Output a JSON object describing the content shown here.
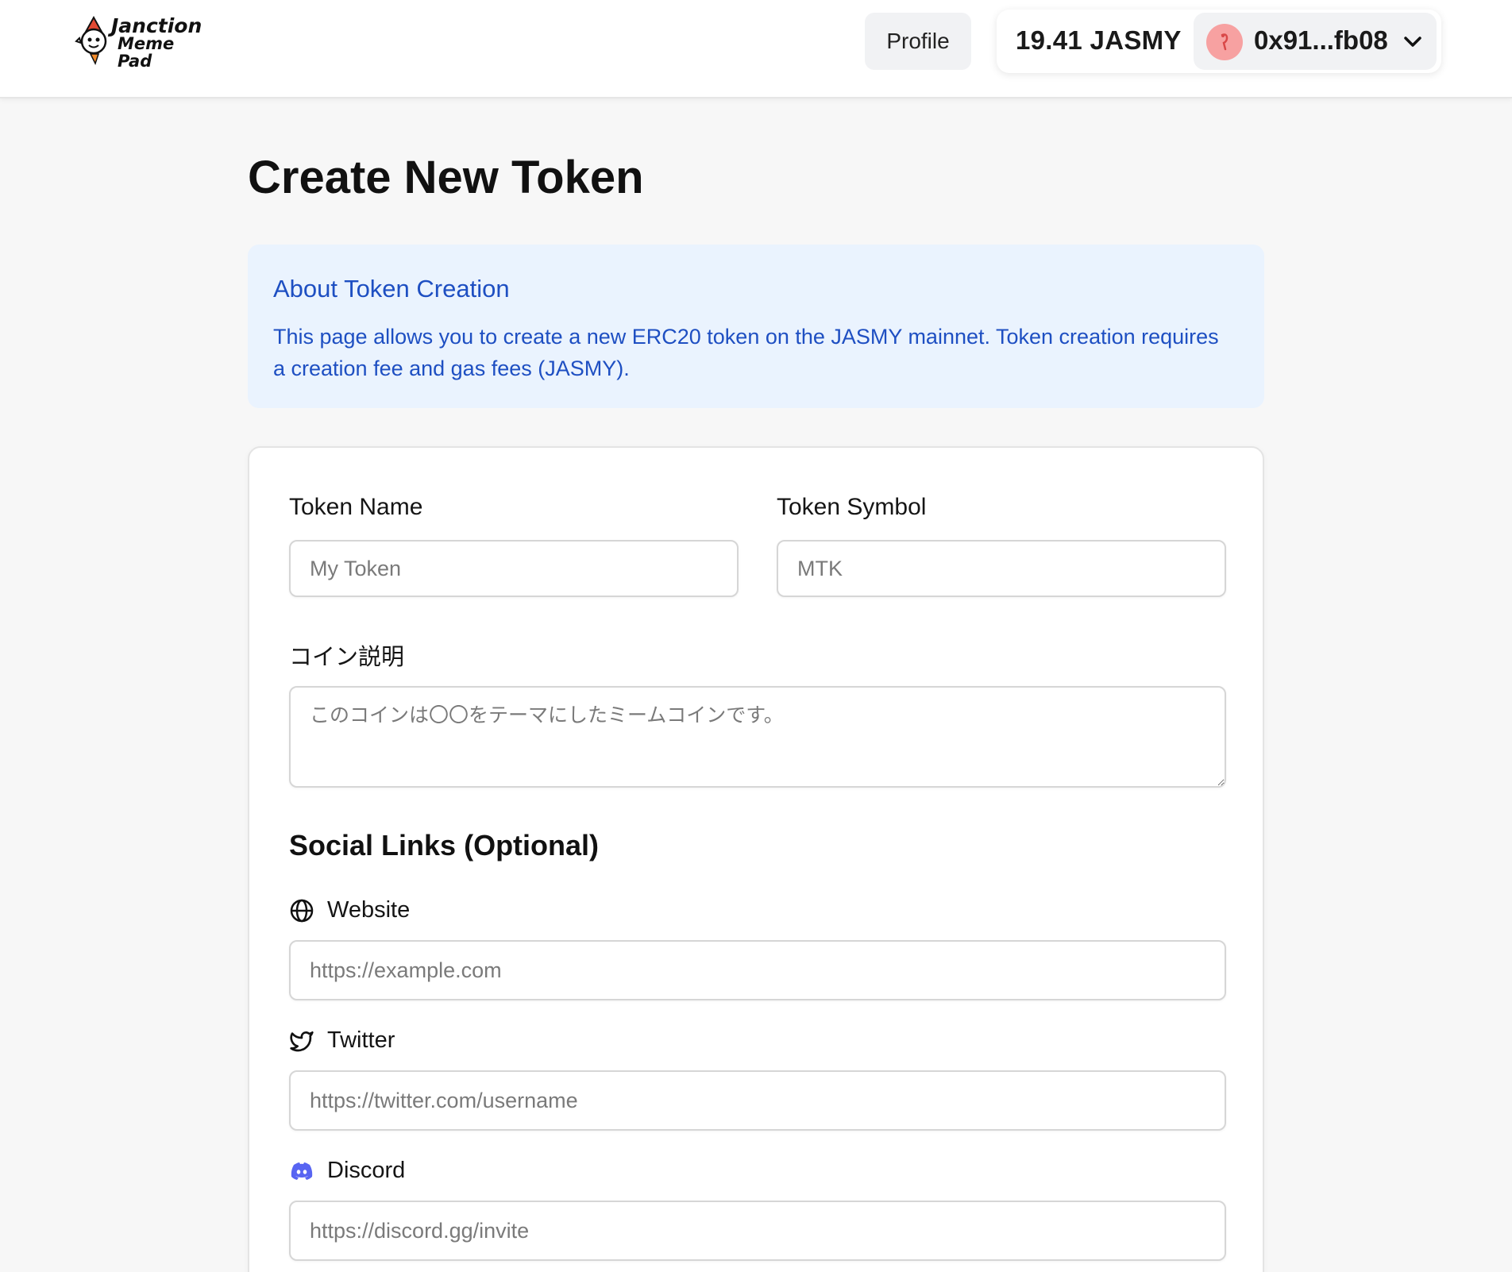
{
  "header": {
    "logo": {
      "line1": "Janction",
      "line2": "Meme Pad"
    },
    "profile_label": "Profile",
    "balance": "19.41 JASMY",
    "address": "0x91...fb08"
  },
  "page": {
    "title": "Create New Token"
  },
  "info": {
    "title": "About Token Creation",
    "text": "This page allows you to create a new ERC20 token on the JASMY mainnet. Token creation requires a creation fee and gas fees (JASMY)."
  },
  "form": {
    "token_name": {
      "label": "Token Name",
      "placeholder": "My Token",
      "value": ""
    },
    "token_symbol": {
      "label": "Token Symbol",
      "placeholder": "MTK",
      "value": ""
    },
    "description": {
      "label": "コイン説明",
      "placeholder": "このコインは〇〇をテーマにしたミームコインです。",
      "value": ""
    },
    "social_title": "Social Links (Optional)",
    "website": {
      "label": "Website",
      "placeholder": "https://example.com",
      "icon": "globe-icon"
    },
    "twitter": {
      "label": "Twitter",
      "placeholder": "https://twitter.com/username",
      "icon": "twitter-icon"
    },
    "discord": {
      "label": "Discord",
      "placeholder": "https://discord.gg/invite",
      "icon": "discord-icon"
    }
  },
  "colors": {
    "info_bg": "#eaf3fe",
    "info_text": "#1e4fc2",
    "discord": "#5865f2",
    "avatar": "#f7a1a1"
  }
}
